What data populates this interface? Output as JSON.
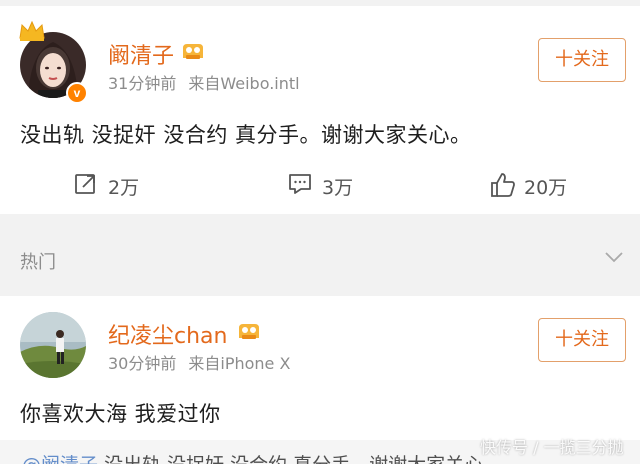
{
  "post": {
    "username": "阚清子",
    "time": "31分钟前",
    "source": "来自Weibo.intl",
    "follow_label": "十关注",
    "content": "没出轨 没捉奸 没合约 真分手。谢谢大家关心。",
    "actions": {
      "repost_count": "2万",
      "comment_count": "3万",
      "like_count": "20万"
    },
    "badge_letter": "v"
  },
  "hot": {
    "label": "热门"
  },
  "comment": {
    "username": "纪凌尘chan",
    "time": "30分钟前",
    "source": "来自iPhone X",
    "follow_label": "十关注",
    "content": "你喜欢大海 我爱过你",
    "quote_mention": "@阚清子",
    "quote_text": "没出轨 没捉奸 没合约 真分手。谢谢大家关心。"
  },
  "watermark": "快传号 / 一揽三分抛",
  "colors": {
    "accent": "#e3691c",
    "mention": "#4a7bc3",
    "meta": "#8c8c8c",
    "background": "#f2f2f2"
  },
  "icons": [
    "crown-icon",
    "verified-badge-icon",
    "level-icon",
    "repost-icon",
    "comment-icon",
    "like-icon",
    "chevron-down-icon"
  ]
}
